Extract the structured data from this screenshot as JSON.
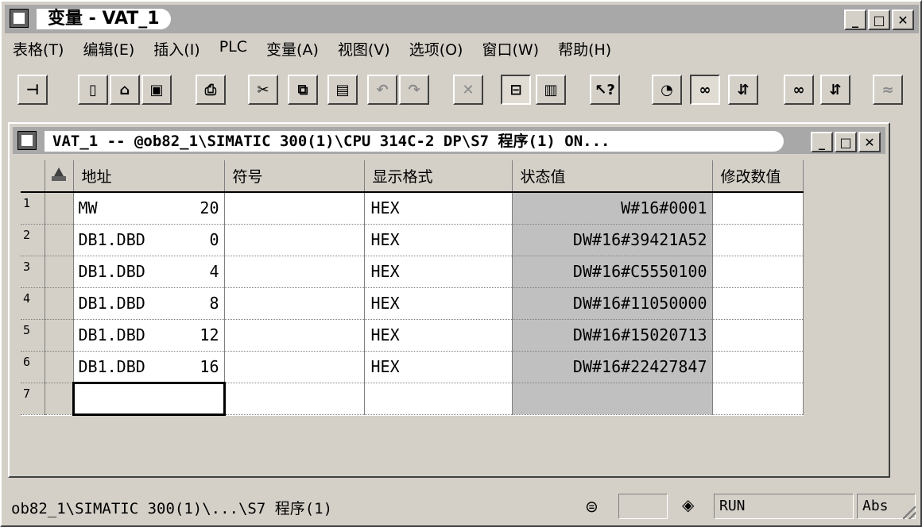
{
  "window": {
    "title": "变量 - VAT_1",
    "buttons": {
      "minimize": "_",
      "maximize": "□",
      "close": "✕"
    }
  },
  "menu": [
    "表格(T)",
    "编辑(E)",
    "插入(I)",
    "PLC",
    "变量(A)",
    "视图(V)",
    "选项(O)",
    "窗口(W)",
    "帮助(H)"
  ],
  "toolbar": {
    "icons": [
      "pin-icon",
      "new-icon",
      "open-icon",
      "save-icon",
      "print-icon",
      "cut-icon",
      "copy-icon",
      "paste-icon",
      "undo-icon",
      "redo-icon",
      "delete-icon",
      "online-offline-icon",
      "plc-icon",
      "help-pointer-icon",
      "monitor-trigger-icon",
      "monitor-icon",
      "modify-icon",
      "monitor-once-icon",
      "modify-once-icon",
      "force-icon"
    ]
  },
  "child": {
    "title": "VAT_1 -- @ob82_1\\SIMATIC 300(1)\\CPU 314C-2 DP\\S7 程序(1)   ON..."
  },
  "table": {
    "headers": {
      "address": "地址",
      "symbol": "符号",
      "format": "显示格式",
      "status": "状态值",
      "modify": "修改数值"
    },
    "rows": [
      {
        "num": "1",
        "addr": "MW",
        "offset": "20",
        "symbol": "",
        "format": "HEX",
        "status": "W#16#0001",
        "modify": ""
      },
      {
        "num": "2",
        "addr": "DB1.DBD",
        "offset": "0",
        "symbol": "",
        "format": "HEX",
        "status": "DW#16#39421A52",
        "modify": ""
      },
      {
        "num": "3",
        "addr": "DB1.DBD",
        "offset": "4",
        "symbol": "",
        "format": "HEX",
        "status": "DW#16#C5550100",
        "modify": ""
      },
      {
        "num": "4",
        "addr": "DB1.DBD",
        "offset": "8",
        "symbol": "",
        "format": "HEX",
        "status": "DW#16#11050000",
        "modify": ""
      },
      {
        "num": "5",
        "addr": "DB1.DBD",
        "offset": "12",
        "symbol": "",
        "format": "HEX",
        "status": "DW#16#15020713",
        "modify": ""
      },
      {
        "num": "6",
        "addr": "DB1.DBD",
        "offset": "16",
        "symbol": "",
        "format": "HEX",
        "status": "DW#16#22427847",
        "modify": ""
      },
      {
        "num": "7",
        "addr": "",
        "offset": "",
        "symbol": "",
        "format": "",
        "status": "",
        "modify": ""
      }
    ]
  },
  "status": {
    "path": "ob82_1\\SIMATIC 300(1)\\...\\S7 程序(1)",
    "mode": "RUN",
    "abs": "Abs"
  }
}
